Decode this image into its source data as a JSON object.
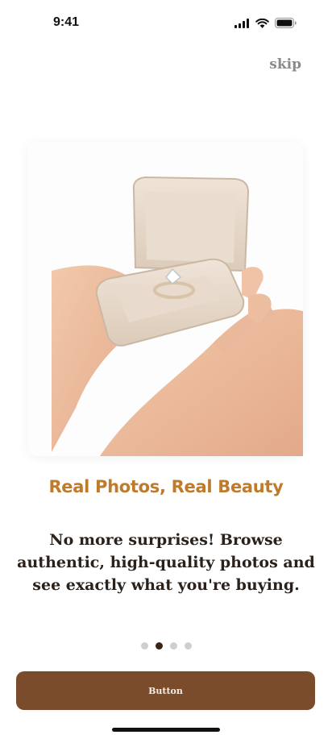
{
  "status_bar": {
    "time": "9:41"
  },
  "header": {
    "skip_label": "skip"
  },
  "onboarding": {
    "headline": "Real Photos, Real Beauty",
    "description": "No more surprises! Browse authentic, high-quality photos and see exactly what you're buying.",
    "pagination": {
      "total": 4,
      "active_index": 1
    }
  },
  "footer": {
    "button_label": "Button"
  },
  "colors": {
    "accent": "#c07a2c",
    "button": "#7a4c2b",
    "dot_active": "#3a2416",
    "dot_inactive": "#cfcfcf"
  },
  "icons": [
    "signal-icon",
    "wifi-icon",
    "battery-icon"
  ]
}
